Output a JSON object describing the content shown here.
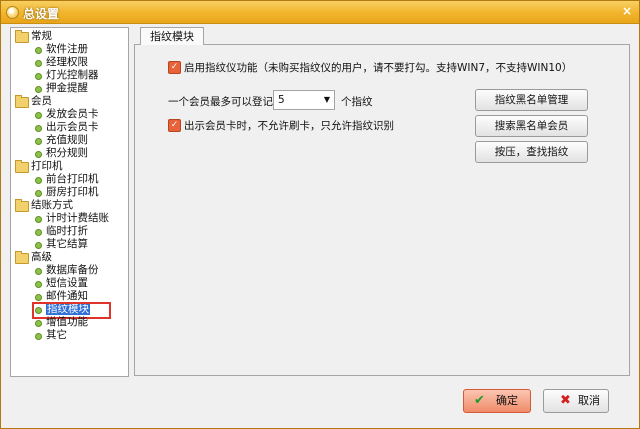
{
  "window": {
    "title": "总设置",
    "close_glyph": "×"
  },
  "tree": [
    {
      "label": "常规",
      "items": [
        "软件注册",
        "经理权限",
        "灯光控制器",
        "押金提醒"
      ]
    },
    {
      "label": "会员",
      "items": [
        "发放会员卡",
        "出示会员卡",
        "充值规则",
        "积分规则"
      ]
    },
    {
      "label": "打印机",
      "items": [
        "前台打印机",
        "厨房打印机"
      ]
    },
    {
      "label": "结账方式",
      "items": [
        "计时计费结账",
        "临时打折",
        "其它结算"
      ]
    },
    {
      "label": "高级",
      "items": [
        "数据库备份",
        "短信设置",
        "邮件通知",
        "指纹模块",
        "增值功能",
        "其它"
      ]
    }
  ],
  "tree_selected": "指纹模块",
  "panel": {
    "tab_label": "指纹模块",
    "enable_label": "启用指纹仪功能（未购买指纹仪的用户，请不要打勾。支持WIN7，不支持WIN10）",
    "max_label": "一个会员最多可以登记",
    "max_value": "5",
    "max_unit": "个指纹",
    "show_card_label": "出示会员卡时，不允许刷卡，只允许指纹识别",
    "buttons": [
      "指纹黑名单管理",
      "搜索黑名单会员",
      "按压，查找指纹"
    ]
  },
  "dialog": {
    "ok_label": "确定",
    "cancel_label": "取消"
  },
  "icons": {
    "check": "✓",
    "dropdown": "▼",
    "ok": "✔",
    "cancel": "✖"
  }
}
